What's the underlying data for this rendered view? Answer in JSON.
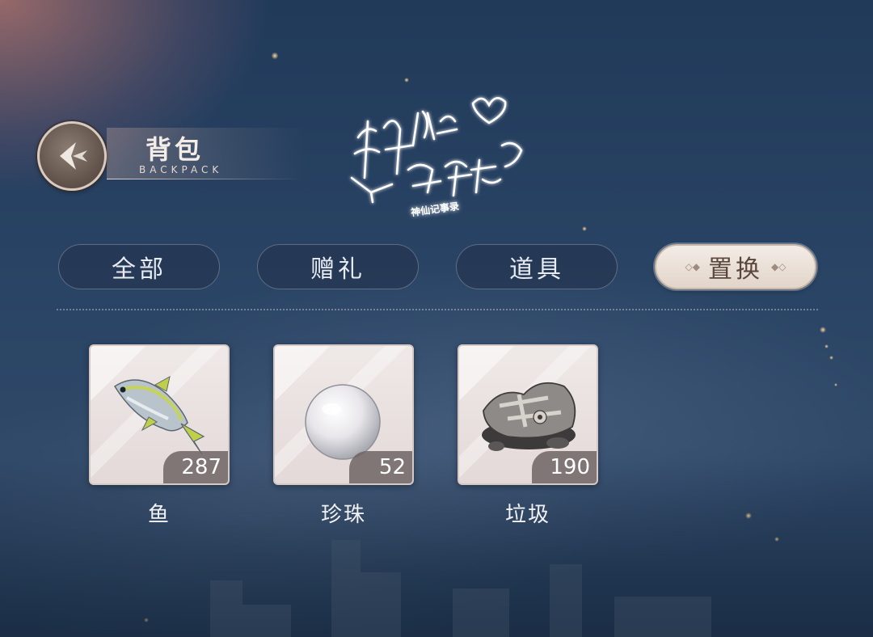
{
  "header": {
    "title": "背包",
    "subtitle": "BACKPACK",
    "logo_text": "神仙记事录"
  },
  "tabs": [
    {
      "label": "全部",
      "active": false
    },
    {
      "label": "赠礼",
      "active": false
    },
    {
      "label": "道具",
      "active": false
    },
    {
      "label": "置换",
      "active": true
    }
  ],
  "items": [
    {
      "name": "鱼",
      "count": "287",
      "icon": "fish-icon"
    },
    {
      "name": "珍珠",
      "count": "52",
      "icon": "pearl-icon"
    },
    {
      "name": "垃圾",
      "count": "190",
      "icon": "junk-icon"
    }
  ],
  "colors": {
    "active_tab_bg": "#efe7e0",
    "active_tab_text": "#5a463d",
    "tab_text": "#e8ecf2",
    "background": "#2a4465"
  }
}
